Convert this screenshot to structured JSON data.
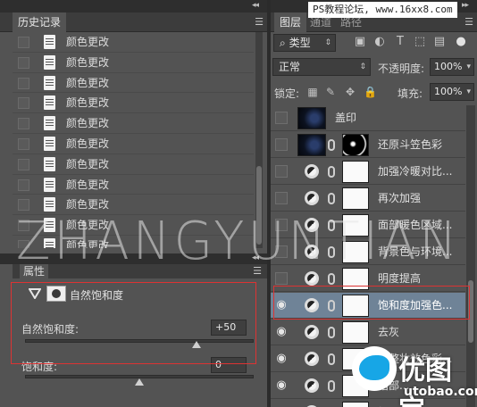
{
  "history_panel": {
    "tab_label": "历史记录",
    "items": [
      "颜色更改",
      "颜色更改",
      "颜色更改",
      "颜色更改",
      "颜色更改",
      "颜色更改",
      "颜色更改",
      "颜色更改",
      "颜色更改",
      "颜色更改",
      "颜色更改"
    ]
  },
  "properties_panel": {
    "tab_label": "属性",
    "adjustment_title": "自然饱和度",
    "vibrance_label": "自然饱和度:",
    "vibrance_value": "+50",
    "vibrance_level": 0.75,
    "saturation_label": "饱和度:",
    "saturation_value": "0",
    "saturation_level": 0.5
  },
  "layers_panel": {
    "tabs": [
      "图层",
      "通道",
      "路径"
    ],
    "site_banner": "PS教程论坛, www.16xx8.com",
    "filter_kind": "类型",
    "blend_mode": "正常",
    "opacity_label": "不透明度:",
    "opacity_value": "100%",
    "lock_label": "锁定:",
    "fill_label": "填充:",
    "fill_value": "100%",
    "layers": [
      {
        "name": "盖印",
        "visible": false,
        "kind": "image"
      },
      {
        "name": "还原斗笠色彩",
        "visible": false,
        "kind": "masked-image"
      },
      {
        "name": "加强冷暖对比...",
        "visible": false,
        "kind": "adjustment"
      },
      {
        "name": "再次加强",
        "visible": false,
        "kind": "adjustment"
      },
      {
        "name": "面部暖色区域...",
        "visible": false,
        "kind": "adjustment"
      },
      {
        "name": "背景色与环境...",
        "visible": false,
        "kind": "adjustment"
      },
      {
        "name": "明度提高",
        "visible": false,
        "kind": "adjustment"
      },
      {
        "name": "饱和度加强色...",
        "visible": true,
        "kind": "adjustment",
        "selected": true
      },
      {
        "name": "去灰",
        "visible": true,
        "kind": "adjustment"
      },
      {
        "name": "调整妆效色彩...",
        "visible": true,
        "kind": "adjustment"
      },
      {
        "name": "暗部...",
        "visible": true,
        "kind": "adjustment"
      },
      {
        "name": "加强...",
        "visible": true,
        "kind": "adjustment"
      }
    ]
  },
  "watermark_text": "ZHANGYUNTIAN",
  "logo": {
    "brand": "优图宝",
    "url": "utobao.com"
  },
  "colors": {
    "panel_bg": "#535353",
    "selected_layer": "#6f8397",
    "highlight_box": "#dd3333",
    "logo_blue": "#17a6e6"
  }
}
